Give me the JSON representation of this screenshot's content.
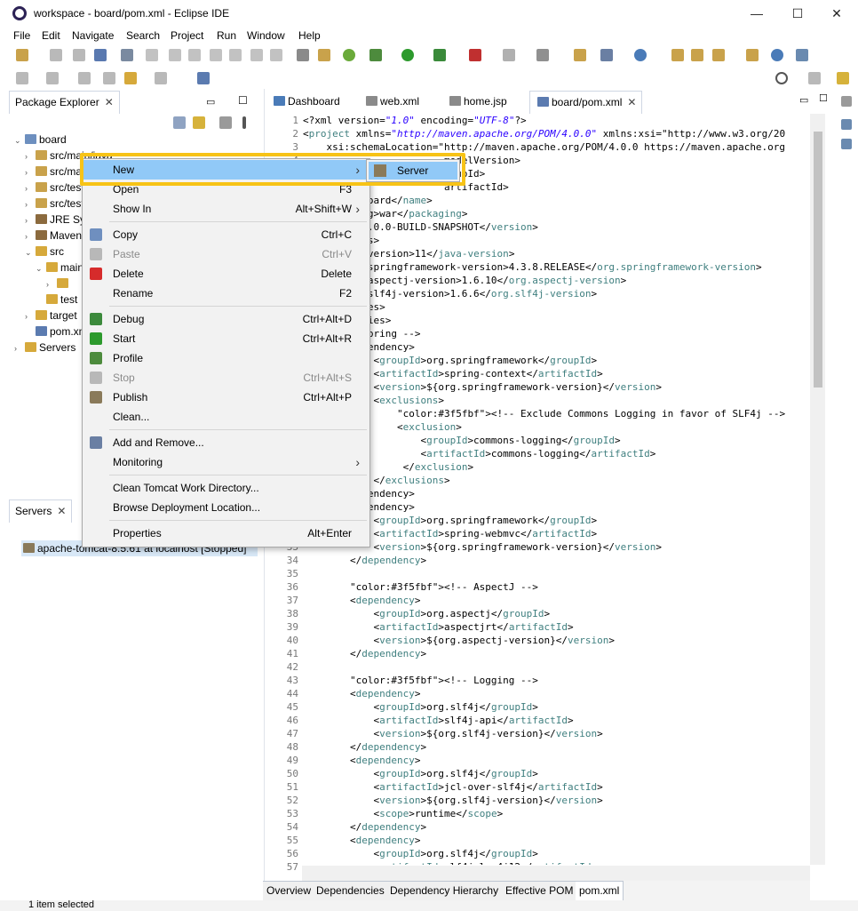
{
  "window": {
    "title": "workspace - board/pom.xml - Eclipse IDE",
    "minimize_glyph": "—",
    "maximize_glyph": "☐",
    "close_glyph": "✕"
  },
  "menubar": [
    "File",
    "Edit",
    "Navigate",
    "Search",
    "Project",
    "Run",
    "Window",
    "Help"
  ],
  "package_explorer": {
    "title": "Package Explorer",
    "tree": [
      {
        "indent": 0,
        "twisty": "⌄",
        "label": "board",
        "icon_color": "#6d8fbf"
      },
      {
        "indent": 1,
        "twisty": "›",
        "label": "src/main/java",
        "icon_color": "#c9a24b"
      },
      {
        "indent": 1,
        "twisty": "›",
        "label": "src/main/resources",
        "icon_color": "#c9a24b"
      },
      {
        "indent": 1,
        "twisty": "›",
        "label": "src/test/java",
        "icon_color": "#c9a24b"
      },
      {
        "indent": 1,
        "twisty": "›",
        "label": "src/test/resources",
        "icon_color": "#c9a24b"
      },
      {
        "indent": 1,
        "twisty": "›",
        "label": "JRE System Library",
        "icon_color": "#8b6a3e"
      },
      {
        "indent": 1,
        "twisty": "›",
        "label": "Maven Dependencies",
        "icon_color": "#8b6a3e"
      },
      {
        "indent": 1,
        "twisty": "⌄",
        "label": "src",
        "icon_color": "#d6a93b"
      },
      {
        "indent": 2,
        "twisty": "⌄",
        "label": "main",
        "icon_color": "#d6a93b"
      },
      {
        "indent": 3,
        "twisty": "›",
        "label": "",
        "icon_color": "#d6a93b"
      },
      {
        "indent": 2,
        "twisty": "",
        "label": "test",
        "icon_color": "#d6a93b"
      },
      {
        "indent": 1,
        "twisty": "›",
        "label": "target",
        "icon_color": "#d6a93b"
      },
      {
        "indent": 1,
        "twisty": "",
        "label": "pom.xml",
        "icon_color": "#5b7bb0"
      },
      {
        "indent": 0,
        "twisty": "›",
        "label": "Servers",
        "icon_color": "#d6a93b"
      }
    ]
  },
  "servers_view": {
    "title": "Servers",
    "row": "apache-tomcat-8.5.61 at localhost  [Stopped]"
  },
  "editor": {
    "tabs": [
      {
        "label": "Dashboard"
      },
      {
        "label": "web.xml"
      },
      {
        "label": "home.jsp"
      },
      {
        "label": "board/pom.xml",
        "active": true
      }
    ],
    "first_line_number": 1,
    "lines": [
      "<?xml version=\"1.0\" encoding=\"UTF-8\"?>",
      "<project xmlns=\"http://maven.apache.org/POM/4.0.0\" xmlns:xsi=\"http://www.w3.org/20",
      "    xsi:schemaLocation=\"http://maven.apache.org/POM/4.0.0 https://maven.apache.org",
      "                        modelVersion>",
      "                        roupId>",
      "                        artifactId>",
      "          board</name>",
      "       aging>war</packaging>",
      "       on>1.0.0-BUILD-SNAPSHOT</version>",
      "       rties>",
      "       ava-version>11</java-version>",
      "       org.springframework-version>4.3.8.RELEASE</org.springframework-version>",
      "       org.aspectj-version>1.6.10</org.aspectj-version>",
      "       org.slf4j-version>1.6.6</org.slf4j-version>",
      "       erties>",
      "       dencies>",
      "       -- Spring -->",
      "        dependency>",
      "            <groupId>org.springframework</groupId>",
      "            <artifactId>spring-context</artifactId>",
      "            <version>${org.springframework-version}</version>",
      "            <exclusions>",
      "                <!-- Exclude Commons Logging in favor of SLF4j -->",
      "                <exclusion>",
      "                    <groupId>commons-logging</groupId>",
      "                    <artifactId>commons-logging</artifactId>",
      "                 </exclusion>",
      "            </exclusions>",
      "        dependency>",
      "        dependency>",
      "            <groupId>org.springframework</groupId>",
      "            <artifactId>spring-webmvc</artifactId>",
      "            <version>${org.springframework-version}</version>",
      "        </dependency>",
      "",
      "        <!-- AspectJ -->",
      "        <dependency>",
      "            <groupId>org.aspectj</groupId>",
      "            <artifactId>aspectjrt</artifactId>",
      "            <version>${org.aspectj-version}</version>",
      "        </dependency>",
      "",
      "        <!-- Logging -->",
      "        <dependency>",
      "            <groupId>org.slf4j</groupId>",
      "            <artifactId>slf4j-api</artifactId>",
      "            <version>${org.slf4j-version}</version>",
      "        </dependency>",
      "        <dependency>",
      "            <groupId>org.slf4j</groupId>",
      "            <artifactId>jcl-over-slf4j</artifactId>",
      "            <version>${org.slf4j-version}</version>",
      "            <scope>runtime</scope>",
      "        </dependency>",
      "        <dependency>",
      "            <groupId>org.slf4j</groupId>",
      "            <artifactId>slf4j-log4j12</artifactId>"
    ],
    "bottom_tabs": [
      "Overview",
      "Dependencies",
      "Dependency Hierarchy",
      "Effective POM",
      "pom.xml"
    ]
  },
  "context_menu": {
    "items": [
      {
        "label": "New",
        "submenu": true,
        "hover": true
      },
      {
        "label": "Open",
        "shortcut": "F3"
      },
      {
        "label": "Show In",
        "shortcut": "Alt+Shift+W",
        "submenu": true
      },
      {
        "sep": true
      },
      {
        "label": "Copy",
        "shortcut": "Ctrl+C",
        "icon": "#6f8fbf"
      },
      {
        "label": "Paste",
        "shortcut": "Ctrl+V",
        "disabled": true,
        "icon": "#b8b8b8"
      },
      {
        "label": "Delete",
        "shortcut": "Delete",
        "icon": "#d62b2b"
      },
      {
        "label": "Rename",
        "shortcut": "F2"
      },
      {
        "sep": true
      },
      {
        "label": "Debug",
        "shortcut": "Ctrl+Alt+D",
        "icon": "#3c8a3c"
      },
      {
        "label": "Start",
        "shortcut": "Ctrl+Alt+R",
        "icon": "#2d9a2d"
      },
      {
        "label": "Profile",
        "icon": "#4d8b3d"
      },
      {
        "label": "Stop",
        "shortcut": "Ctrl+Alt+S",
        "disabled": true,
        "icon": "#b8b8b8"
      },
      {
        "label": "Publish",
        "shortcut": "Ctrl+Alt+P",
        "icon": "#8a7a5a"
      },
      {
        "label": "Clean..."
      },
      {
        "sep": true
      },
      {
        "label": "Add and Remove...",
        "icon": "#6a7fa3"
      },
      {
        "label": "Monitoring",
        "submenu": true
      },
      {
        "sep": true
      },
      {
        "label": "Clean Tomcat Work Directory..."
      },
      {
        "label": "Browse Deployment Location..."
      },
      {
        "sep": true
      },
      {
        "label": "Properties",
        "shortcut": "Alt+Enter"
      }
    ],
    "submenu_item": "Server"
  },
  "status_bar": {
    "text": "1 item selected"
  },
  "colors": {
    "highlight": "#f7c316",
    "menu_hover": "#91c9f7",
    "xml_tag": "#3f7f7f",
    "xml_attr": "#7f007f",
    "xml_value": "#2a00ff",
    "comment": "#3f5fbf"
  }
}
